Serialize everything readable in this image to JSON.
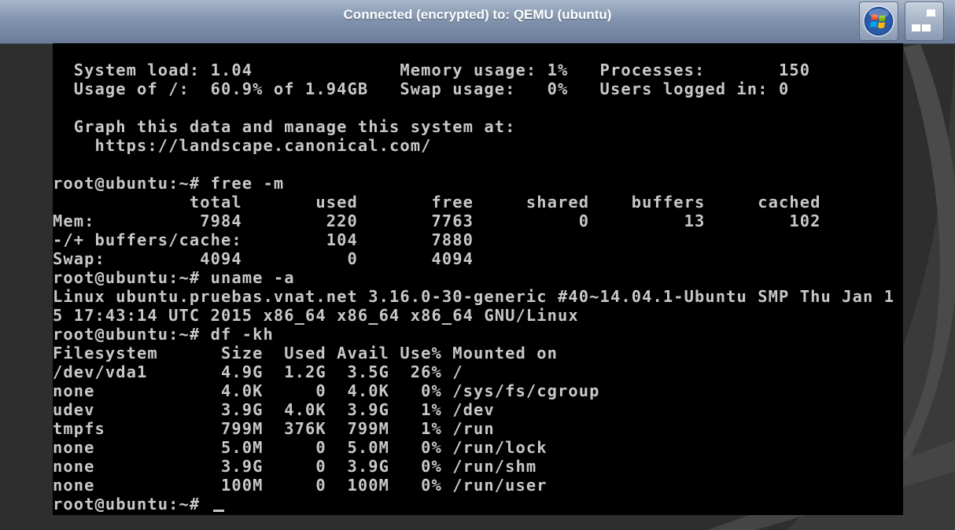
{
  "window": {
    "title": "Connected (encrypted) to: QEMU (ubuntu)",
    "start_button_icon": "windows-orb-icon",
    "restore_button_icon": "restore-window-icon"
  },
  "colors": {
    "titlebar_top": "#a8b7cb",
    "titlebar_bottom": "#6a7c97",
    "terminal_bg": "#000000",
    "terminal_fg": "#c8c8c8",
    "desktop_bg": "#2e2e2e"
  },
  "terminal": {
    "lines": [
      "  System load: 1.04              Memory usage: 1%   Processes:       150",
      "  Usage of /:  60.9% of 1.94GB   Swap usage:   0%   Users logged in: 0",
      "",
      "  Graph this data and manage this system at:",
      "    https://landscape.canonical.com/",
      "",
      "root@ubuntu:~# free -m",
      "             total       used       free     shared    buffers     cached",
      "Mem:          7984        220       7763          0         13        102",
      "-/+ buffers/cache:        104       7880",
      "Swap:         4094          0       4094",
      "root@ubuntu:~# uname -a",
      "Linux ubuntu.pruebas.vnat.net 3.16.0-30-generic #40~14.04.1-Ubuntu SMP Thu Jan 1",
      "5 17:43:14 UTC 2015 x86_64 x86_64 x86_64 GNU/Linux",
      "root@ubuntu:~# df -kh",
      "Filesystem      Size  Used Avail Use% Mounted on",
      "/dev/vda1       4.9G  1.2G  3.5G  26% /",
      "none            4.0K     0  4.0K   0% /sys/fs/cgroup",
      "udev            3.9G  4.0K  3.9G   1% /dev",
      "tmpfs           799M  376K  799M   1% /run",
      "none            5.0M     0  5.0M   0% /run/lock",
      "none            3.9G     0  3.9G   0% /run/shm",
      "none            100M     0  100M   0% /run/user",
      "root@ubuntu:~# "
    ]
  }
}
